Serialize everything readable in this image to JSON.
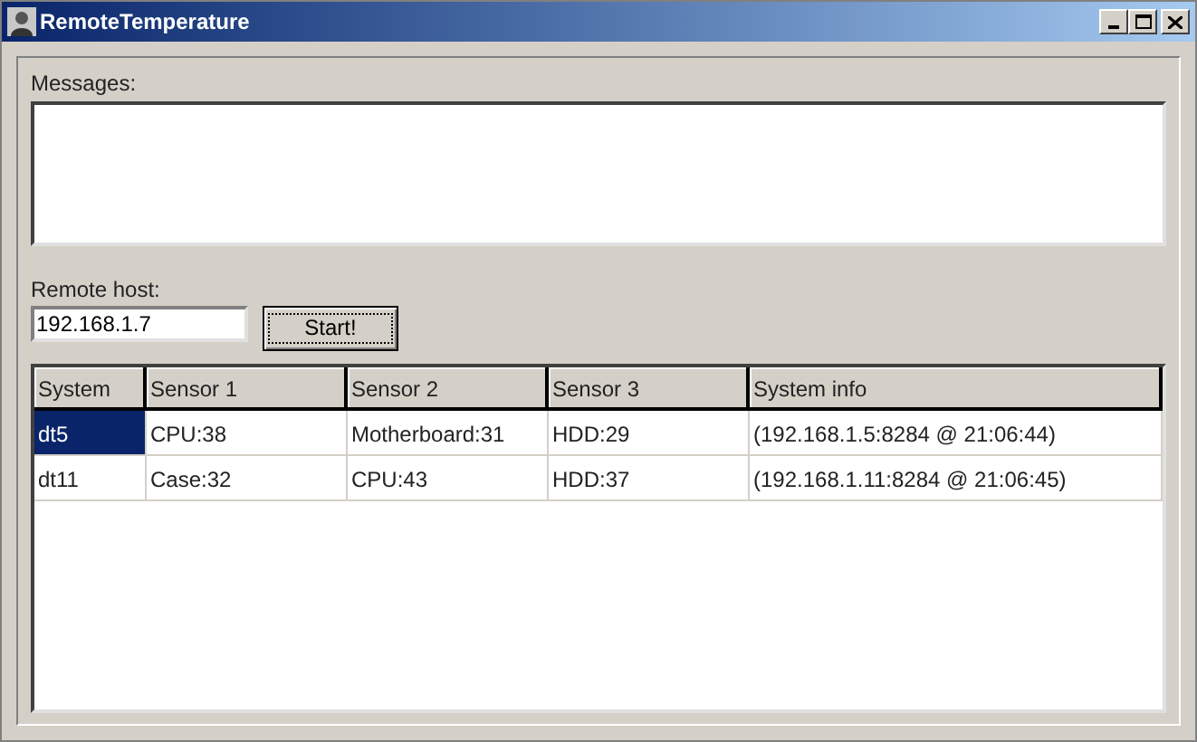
{
  "window": {
    "title": "RemoteTemperature"
  },
  "messages": {
    "label": "Messages:"
  },
  "remote_host": {
    "label": "Remote host:",
    "value": "192.168.1.7"
  },
  "start_button": {
    "label": "Start!"
  },
  "table": {
    "columns": [
      "System",
      "Sensor 1",
      "Sensor 2",
      "Sensor 3",
      "System info"
    ],
    "rows": [
      {
        "selected": true,
        "cells": [
          "dt5",
          "CPU:38",
          "Motherboard:31",
          "HDD:29",
          "(192.168.1.5:8284 @ 21:06:44)"
        ]
      },
      {
        "selected": false,
        "cells": [
          "dt11",
          "Case:32",
          "CPU:43",
          "HDD:37",
          "(192.168.1.11:8284 @ 21:06:45)"
        ]
      }
    ]
  }
}
